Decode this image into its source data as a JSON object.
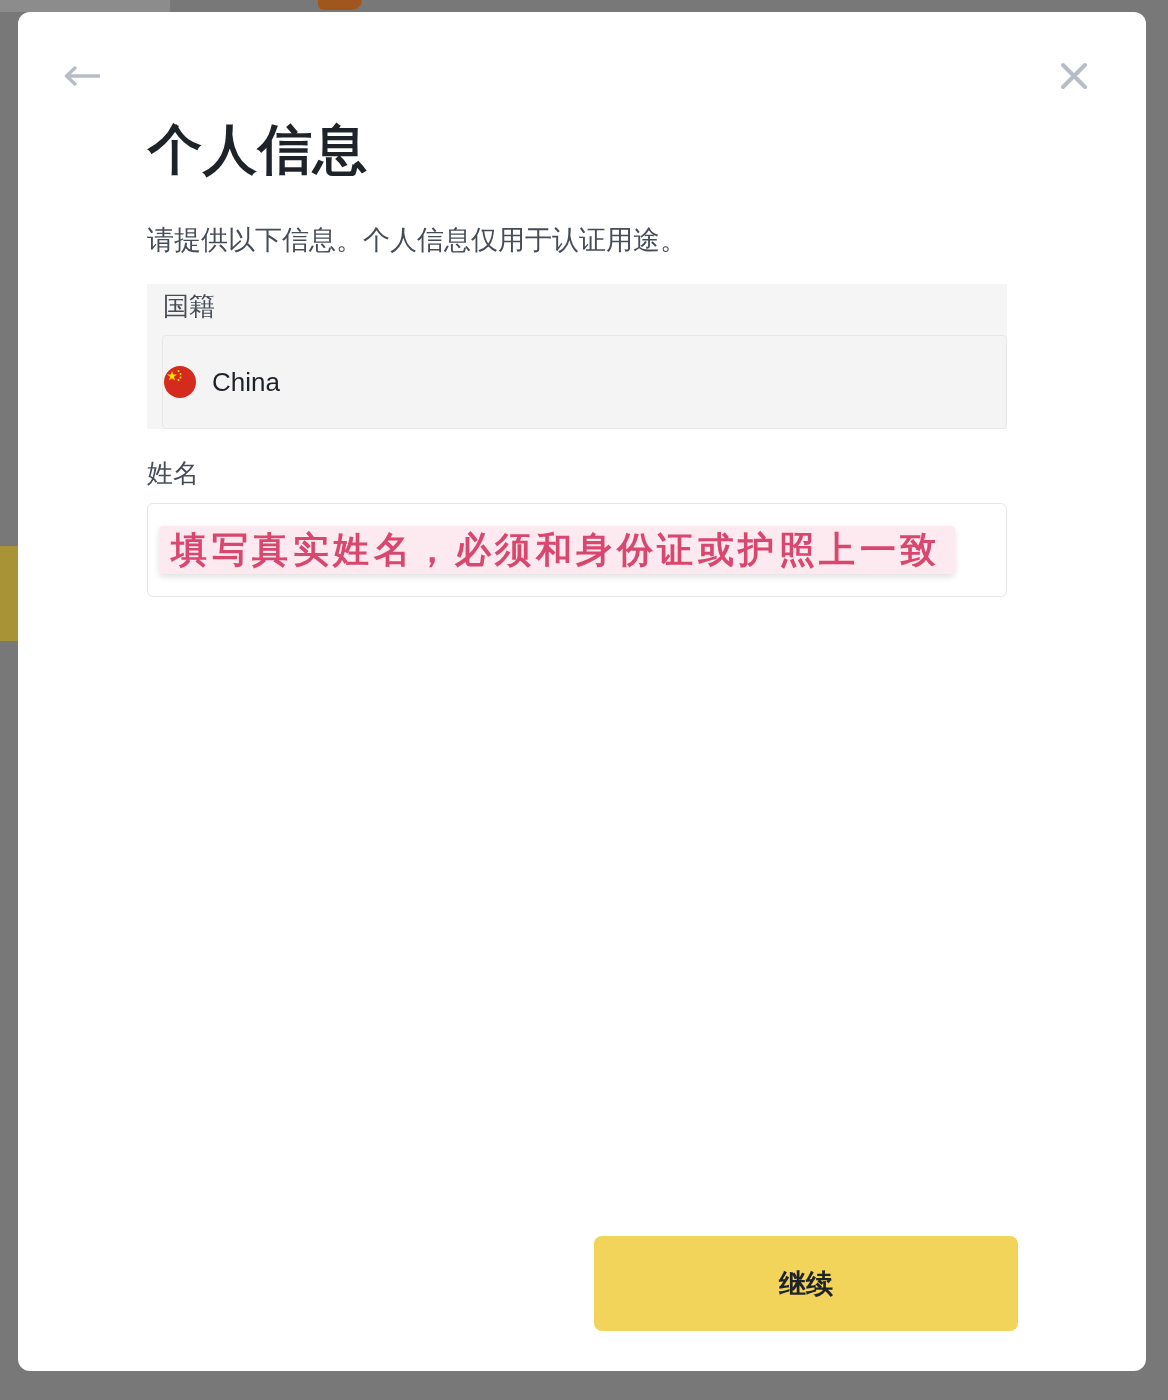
{
  "title": "个人信息",
  "subtitle": "请提供以下信息。个人信息仅用于认证用途。",
  "nationality": {
    "label": "国籍",
    "value": "China",
    "disabled": true
  },
  "name_field": {
    "label": "姓名",
    "annotation": "填写真实姓名，必须和身份证或护照上一致"
  },
  "continue_button": {
    "label": "继续"
  }
}
